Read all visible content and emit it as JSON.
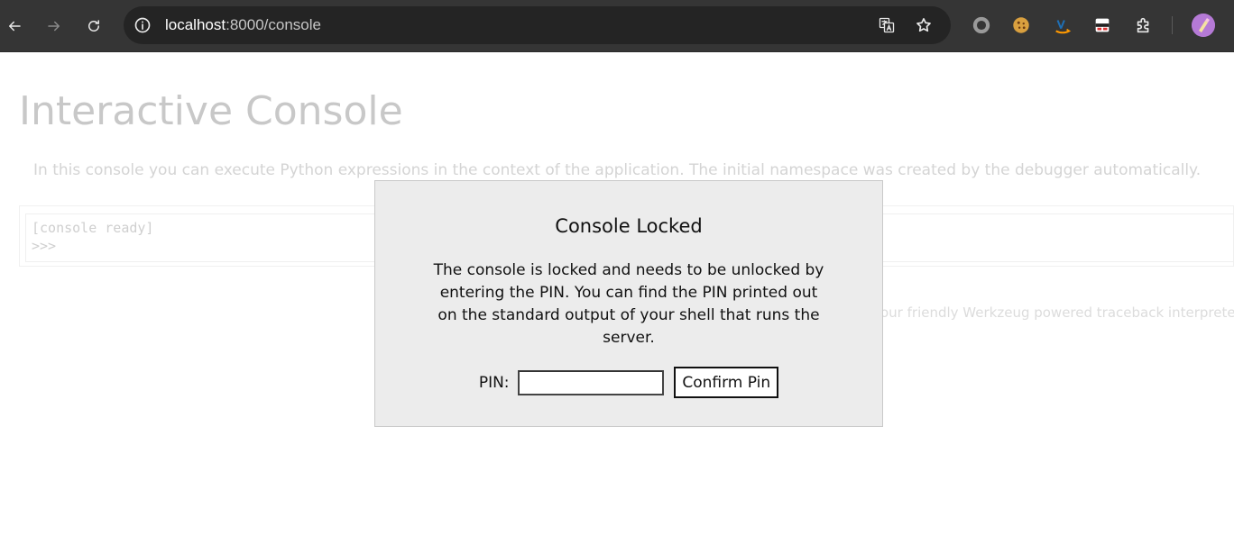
{
  "browser": {
    "url_host": "localhost",
    "url_path": ":8000/console",
    "icons": [
      "back-icon",
      "forward-icon",
      "reload-icon",
      "site-info-icon",
      "translate-icon",
      "bookmark-star-icon",
      "extensions-icon",
      "avatar"
    ]
  },
  "page": {
    "title": "Interactive Console",
    "intro": "In this console you can execute Python expressions in the context of the application. The initial namespace was created by the debugger automatically.",
    "console_lines": [
      "[console ready]",
      ">>>"
    ],
    "footer": "our friendly Werkzeug powered traceback interpreter"
  },
  "modal": {
    "title": "Console Locked",
    "message": "The console is locked and needs to be unlocked by entering the PIN. You can find the PIN printed out on the standard output of your shell that runs the server.",
    "pin_label": "PIN:",
    "pin_value": "",
    "confirm_label": "Confirm Pin"
  },
  "colors": {
    "chrome_bg": "#353535",
    "omnibox_bg": "#242424",
    "modal_bg": "#ececec",
    "faded_text": "#c8c8c8"
  }
}
